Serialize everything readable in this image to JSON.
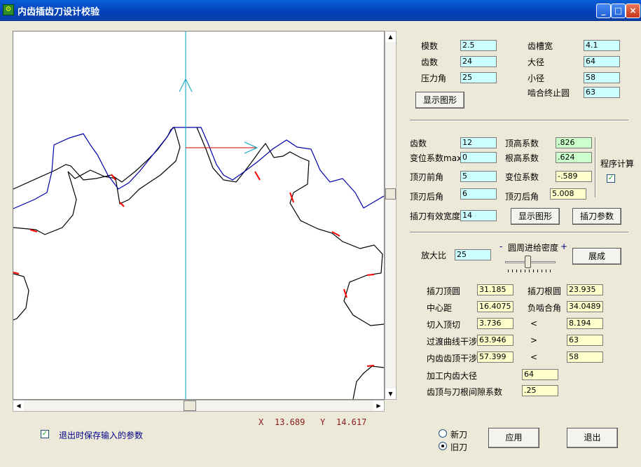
{
  "window": {
    "title": "内齿插齿刀设计校验",
    "icon": "gear-app-icon",
    "minimize": "_",
    "maximize": "□",
    "close": "×"
  },
  "colors": {
    "gear_outline": "#000000",
    "cutter_outline": "#0000aa",
    "interference": "#ff0000",
    "axis": "#00a0c0"
  },
  "coords": {
    "x_label": "X",
    "x_value": "13.689",
    "y_label": "Y",
    "y_value": "14.617"
  },
  "save_on_exit": {
    "label": "退出时保存输入的参数",
    "checked": true,
    "mark": "✓"
  },
  "gear": {
    "module_label": "模数",
    "module": "2.5",
    "teeth_label": "齿数",
    "teeth": "24",
    "pressure_angle_label": "压力角",
    "pressure_angle": "25",
    "slot_width_label": "齿槽宽",
    "slot_width": "4.1",
    "major_dia_label": "大径",
    "major_dia": "64",
    "minor_dia_label": "小径",
    "minor_dia": "58",
    "mesh_end_circle_label": "啮合终止圆",
    "mesh_end_circle": "63",
    "show_button": "显示图形"
  },
  "cutter": {
    "teeth_label": "齿数",
    "teeth": "12",
    "addendum_coef_label": "顶高系数",
    "addendum_coef": ".826",
    "shift_max_label": "变位系数max",
    "shift_max": "0",
    "dedendum_coef_label": "根高系数",
    "dedendum_coef": ".624",
    "top_rake_label": "顶刃前角",
    "top_rake": "5",
    "shift_coef_label": "变位系数",
    "shift_coef": "-.589",
    "top_relief_label": "顶刃后角",
    "top_relief": "6",
    "top_relief2_label": "顶刃后角",
    "top_relief2": "5.008",
    "effective_width_label": "插刀有效宽度",
    "effective_width": "14",
    "program_calc_label": "程序计算",
    "program_calc_mark": "✓",
    "show_button": "显示图形",
    "params_button": "插刀参数"
  },
  "sim": {
    "zoom_label": "放大比",
    "zoom": "25",
    "density_label": "圆周进给密度",
    "minus": "-",
    "plus": "+",
    "density_level": 0.45,
    "expand_button": "展成"
  },
  "results": {
    "cutter_tip_label": "插刀顶圆",
    "cutter_tip": "31.185",
    "cutter_root_label": "插刀根圆",
    "cutter_root": "23.935",
    "center_dist_label": "中心距",
    "center_dist": "16.4075",
    "neg_mesh_label": "负啮合角",
    "neg_mesh": "34.0489",
    "cut_in_label": "切入顶切",
    "cut_in": "3.736",
    "cut_in_op": "<",
    "cut_in_ref": "8.194",
    "transition_label": "过渡曲线干涉",
    "transition": "63.946",
    "transition_op": ">",
    "transition_ref": "63",
    "tip_interf_label": "内齿齿顶干涉",
    "tip_interf": "57.399",
    "tip_interf_op": "<",
    "tip_interf_ref": "58",
    "machining_dia_label": "加工内齿大径",
    "machining_dia": "64",
    "clearance_label": "齿顶与刀根间隙系数",
    "clearance": ".25"
  },
  "tool_mode": {
    "new_label": "新刀",
    "old_label": "旧刀",
    "selected": "old"
  },
  "actions": {
    "apply": "应用",
    "exit": "退出"
  }
}
